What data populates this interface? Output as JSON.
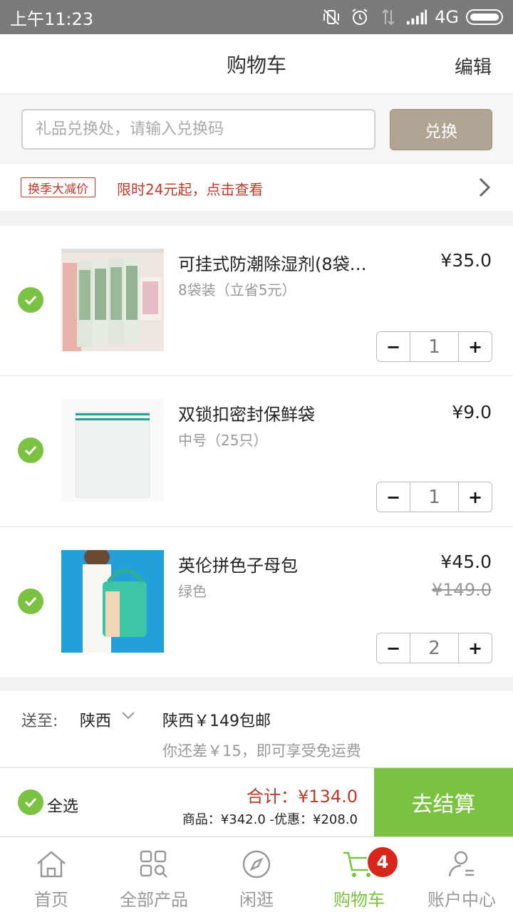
{
  "status_bar": {
    "time": "上午11:23",
    "network": "4G"
  },
  "header": {
    "title": "购物车",
    "edit_label": "编辑"
  },
  "redeem": {
    "placeholder": "礼品兑换处，请输入兑换码",
    "button_label": "兑换"
  },
  "promo": {
    "tag": "换季大减价",
    "text": "限时24元起，点击查看"
  },
  "cart_items": [
    {
      "name": "可挂式防潮除湿剂(8袋…",
      "spec": "8袋装（立省5元）",
      "price": "¥35.0",
      "old_price": "",
      "quantity": "1",
      "checked": true
    },
    {
      "name": "双锁扣密封保鲜袋",
      "spec": "中号（25只）",
      "price": "¥9.0",
      "old_price": "",
      "quantity": "1",
      "checked": true
    },
    {
      "name": "英伦拼色子母包",
      "spec": "绿色",
      "price": "¥45.0",
      "old_price": "¥149.0",
      "quantity": "2",
      "checked": true
    }
  ],
  "stepper": {
    "minus": "−",
    "plus": "+"
  },
  "shipping": {
    "label": "送至:",
    "province": "陕西",
    "rule": "陕西￥149包邮",
    "hint": "你还差￥15，即可享受免运费"
  },
  "checkout": {
    "select_all": "全选",
    "total": "合计：¥134.0",
    "detail": "商品：¥342.0 -优惠：¥208.0",
    "button": "去结算"
  },
  "tabs": [
    {
      "label": "首页",
      "icon": "home-icon"
    },
    {
      "label": "全部产品",
      "icon": "grid-search-icon"
    },
    {
      "label": "闲逛",
      "icon": "compass-icon"
    },
    {
      "label": "购物车",
      "icon": "cart-icon",
      "badge": "4",
      "active": true
    },
    {
      "label": "账户中心",
      "icon": "user-icon"
    }
  ],
  "colors": {
    "accent": "#7cc242",
    "promo_red": "#c0392b",
    "redeem_button": "#b0a595",
    "badge": "#d9261c"
  }
}
